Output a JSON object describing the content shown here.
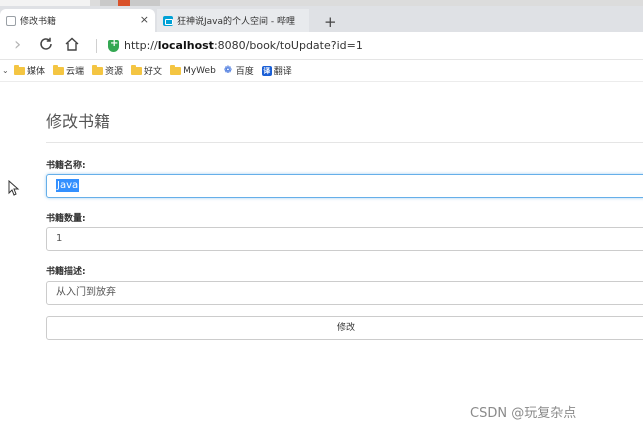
{
  "browser": {
    "tabs": [
      {
        "label": "修改书籍",
        "close": "×"
      },
      {
        "label": "狂神说Java的个人空间 - 哔哩哔哩"
      }
    ],
    "new_tab": "+",
    "url_prefix": "http://",
    "url_host": "localhost",
    "url_rest": ":8080/book/toUpdate?id=1",
    "bookmarks_chevron": "⌄",
    "bookmarks": [
      {
        "label": "媒体"
      },
      {
        "label": "云端"
      },
      {
        "label": "资源"
      },
      {
        "label": "好文"
      },
      {
        "label": "MyWeb"
      },
      {
        "label": "百度"
      },
      {
        "label": "翻译"
      }
    ],
    "translate_glyph": "译"
  },
  "page": {
    "title": "修改书籍",
    "fields": [
      {
        "label": "书籍名称:",
        "value": "Java"
      },
      {
        "label": "书籍数量:",
        "value": "1"
      },
      {
        "label": "书籍描述:",
        "value": "从入门到放弃"
      }
    ],
    "submit_label": "修改"
  },
  "watermark": "CSDN @玩复杂点",
  "colors": {
    "accent": "#66afe9",
    "selection": "#3390ff"
  }
}
